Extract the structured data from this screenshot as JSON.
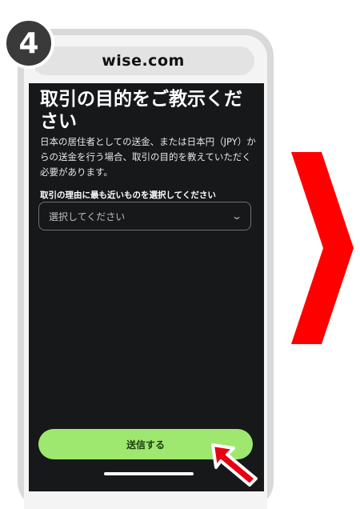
{
  "step": {
    "number": "4"
  },
  "browser": {
    "url": "wise.com"
  },
  "form": {
    "title": "取引の目的をご教示ください",
    "description": "日本の居住者としての送金、または日本円（JPY）からの送金を行う場合、取引の目的を教えていただく必要があります。",
    "select_label": "取引の理由に最も近いものを選択してください",
    "select_placeholder": "選択してください",
    "submit_label": "送信する"
  },
  "colors": {
    "screen_bg": "#17181a",
    "submit_bg": "#9fe870",
    "next_chevron": "#ff0000",
    "pointer_arrow": "#e60012"
  },
  "icons": {
    "select_toggle": "chevron-down-icon",
    "next": "chevron-right-icon",
    "pointer": "pointer-arrow-icon"
  }
}
